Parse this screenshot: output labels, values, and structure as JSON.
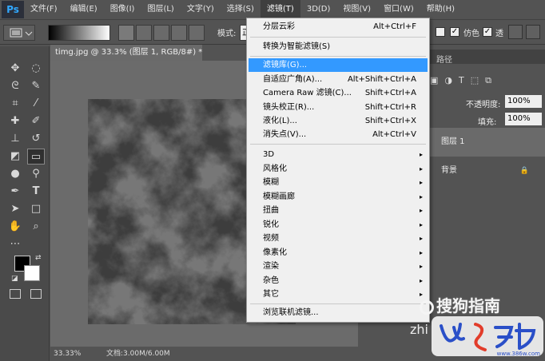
{
  "app": {
    "logo": "Ps"
  },
  "menubar": {
    "items": [
      "文件(F)",
      "编辑(E)",
      "图像(I)",
      "图层(L)",
      "文字(Y)",
      "选择(S)",
      "滤镜(T)",
      "3D(D)",
      "视图(V)",
      "窗口(W)",
      "帮助(H)"
    ]
  },
  "options_bar": {
    "mode_label": "模式:",
    "mode_value": "正",
    "dither_label": "仿色",
    "transparency_label": "透"
  },
  "document": {
    "tab_title": "timg.jpg @ 33.3% (图层 1, RGB/8#) *",
    "zoom": "33.33%",
    "doc_info": "文档:3.00M/6.00M"
  },
  "layers_panel": {
    "paths_tab": "路径",
    "opacity_label": "不透明度:",
    "opacity_value": "100%",
    "fill_label": "填充:",
    "fill_value": "100%",
    "layers": [
      "图层 1",
      "背景"
    ]
  },
  "filter_menu": {
    "items": [
      {
        "label": "分层云彩",
        "shortcut": "Alt+Ctrl+F"
      },
      {
        "label": "转换为智能滤镜(S)",
        "shortcut": ""
      },
      {
        "label": "滤镜库(G)...",
        "shortcut": ""
      },
      {
        "label": "自适应广角(A)...",
        "shortcut": "Alt+Shift+Ctrl+A"
      },
      {
        "label": "Camera Raw 滤镜(C)...",
        "shortcut": "Shift+Ctrl+A"
      },
      {
        "label": "镜头校正(R)...",
        "shortcut": "Shift+Ctrl+R"
      },
      {
        "label": "液化(L)...",
        "shortcut": "Shift+Ctrl+X"
      },
      {
        "label": "消失点(V)...",
        "shortcut": "Alt+Ctrl+V"
      },
      {
        "label": "3D"
      },
      {
        "label": "风格化"
      },
      {
        "label": "模糊"
      },
      {
        "label": "模糊画廊"
      },
      {
        "label": "扭曲"
      },
      {
        "label": "锐化"
      },
      {
        "label": "视频"
      },
      {
        "label": "像素化"
      },
      {
        "label": "渲染"
      },
      {
        "label": "杂色"
      },
      {
        "label": "其它"
      },
      {
        "label": "浏览联机滤镜..."
      }
    ],
    "arrow": "▸"
  },
  "watermarks": {
    "sogou": "搜狗指南",
    "zhi": "zhi",
    "site": "www.386w.com"
  },
  "colors": {
    "menu_highlight": "#3399ff",
    "ui_bg": "#535353"
  }
}
